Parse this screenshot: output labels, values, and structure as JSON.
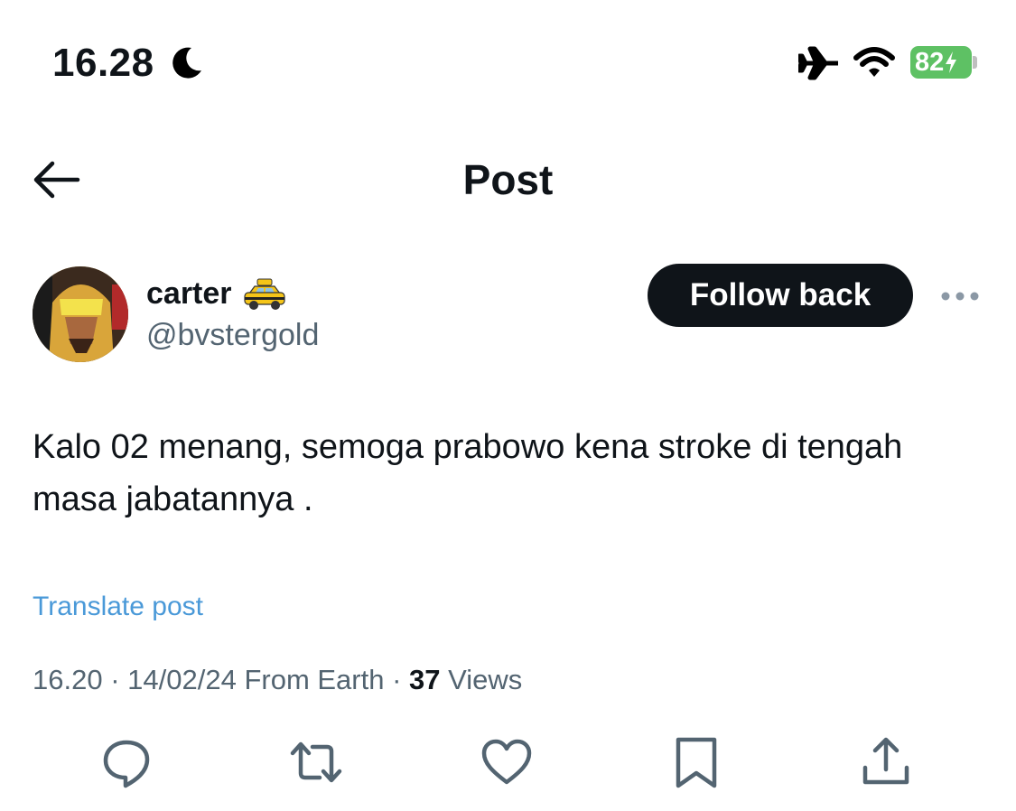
{
  "status_bar": {
    "time": "16.28",
    "battery": "82"
  },
  "header": {
    "title": "Post"
  },
  "author": {
    "display_name": "carter",
    "handle": "@bvstergold",
    "follow_label": "Follow back"
  },
  "tweet": {
    "text": "Kalo 02 menang, semoga prabowo kena stroke di tengah masa jabatannya .",
    "translate_label": "Translate post",
    "time": "16.20",
    "date": "14/02/24",
    "source": "From Earth",
    "views_count": "37",
    "views_label": "Views"
  },
  "colors": {
    "link": "#4a99d8",
    "secondary_text": "#536471",
    "battery": "#5ec164",
    "primary": "#0f1419"
  },
  "icons": {
    "reply": "reply-icon",
    "repost": "repost-icon",
    "like": "like-icon",
    "bookmark": "bookmark-icon",
    "share": "share-icon"
  }
}
